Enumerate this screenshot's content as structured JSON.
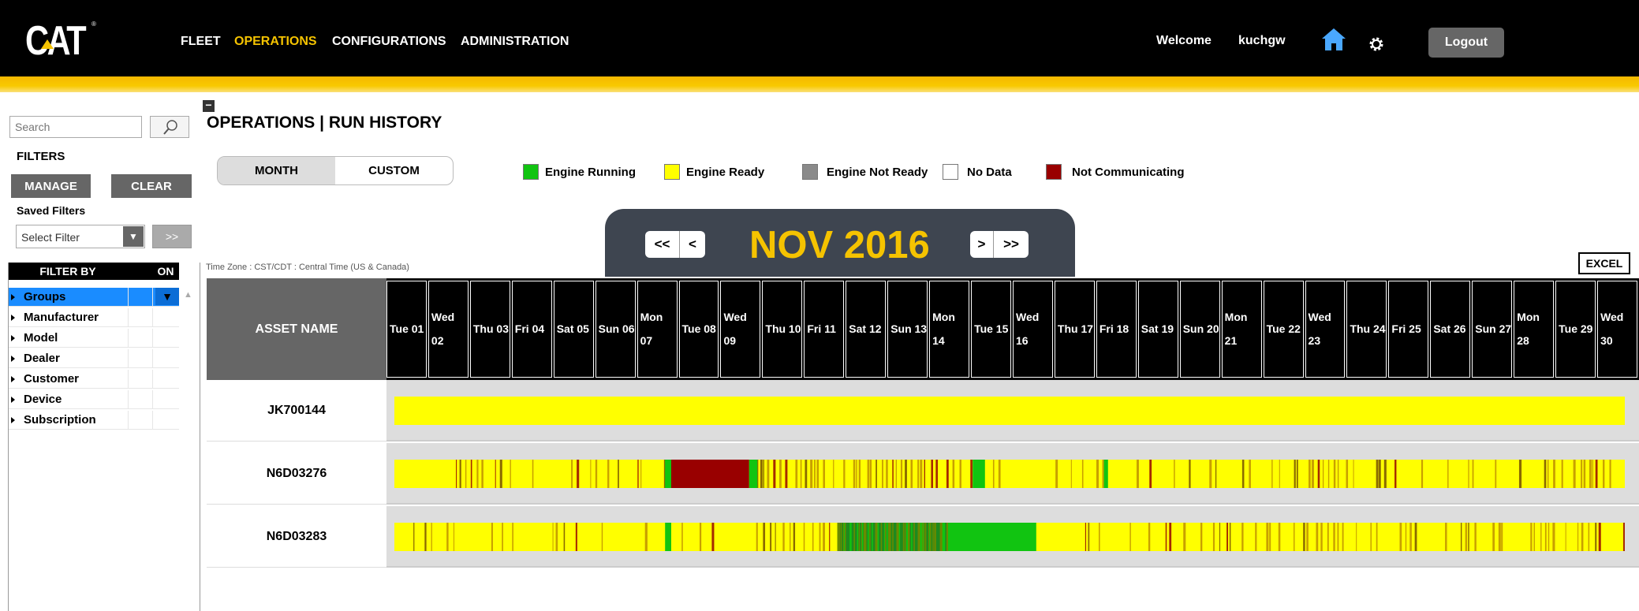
{
  "header": {
    "logo": "CAT",
    "nav": [
      "FLEET",
      "OPERATIONS",
      "CONFIGURATIONS",
      "ADMINISTRATION"
    ],
    "active_nav": "OPERATIONS",
    "welcome": "Welcome",
    "username": "kuchgw",
    "logout_label": "Logout",
    "home_icon": "home-icon",
    "settings_icon": "gear-icon"
  },
  "sidebar": {
    "search_placeholder": "Search",
    "filters_label": "FILTERS",
    "manage_label": "MANAGE",
    "clear_label": "CLEAR",
    "saved_filters_label": "Saved Filters",
    "select_filter": "Select Filter",
    "go_label": ">>",
    "filter_by_label": "FILTER BY",
    "on_label": "ON",
    "filter_items": [
      "Groups",
      "Manufacturer",
      "Model",
      "Dealer",
      "Customer",
      "Device",
      "Subscription"
    ],
    "selected_item": "Groups"
  },
  "main": {
    "collapse_label": "−",
    "page_title": "OPERATIONS | RUN HISTORY",
    "view_modes": [
      "MONTH",
      "CUSTOM"
    ],
    "selected_view": "MONTH",
    "legend": [
      {
        "label": "Engine Running",
        "color": "#11c411"
      },
      {
        "label": "Engine Ready",
        "color": "#ffff00"
      },
      {
        "label": "Engine Not Ready",
        "color": "#8a8a8a"
      },
      {
        "label": "No Data",
        "color": "#ffffff"
      },
      {
        "label": "Not Communicating",
        "color": "#990000"
      }
    ],
    "month_title": "NOV 2016",
    "prev_year_label": "<<",
    "prev_month_label": "<",
    "next_month_label": ">",
    "next_year_label": ">>",
    "timezone": "Time Zone : CST/CDT : Central Time (US & Canada)",
    "excel_label": "EXCEL",
    "asset_header": "ASSET NAME",
    "days": [
      [
        "Tue 01",
        ""
      ],
      [
        "Wed",
        "02"
      ],
      [
        "Thu 03",
        ""
      ],
      [
        "Fri 04",
        ""
      ],
      [
        "Sat 05",
        ""
      ],
      [
        "Sun 06",
        ""
      ],
      [
        "Mon",
        "07"
      ],
      [
        "Tue 08",
        ""
      ],
      [
        "Wed",
        "09"
      ],
      [
        "Thu 10",
        ""
      ],
      [
        "Fri 11",
        ""
      ],
      [
        "Sat 12",
        ""
      ],
      [
        "Sun 13",
        ""
      ],
      [
        "Mon",
        "14"
      ],
      [
        "Tue 15",
        ""
      ],
      [
        "Wed",
        "16"
      ],
      [
        "Thu 17",
        ""
      ],
      [
        "Fri 18",
        ""
      ],
      [
        "Sat 19",
        ""
      ],
      [
        "Sun 20",
        ""
      ],
      [
        "Mon",
        "21"
      ],
      [
        "Tue 22",
        ""
      ],
      [
        "Wed",
        "23"
      ],
      [
        "Thu 24",
        ""
      ],
      [
        "Fri 25",
        ""
      ],
      [
        "Sat 26",
        ""
      ],
      [
        "Sun 27",
        ""
      ],
      [
        "Mon",
        "28"
      ],
      [
        "Tue 29",
        ""
      ],
      [
        "Wed",
        "30"
      ]
    ],
    "assets": [
      {
        "name": "JK700144",
        "segments": [
          {
            "from": 0,
            "to": 30,
            "state": "ready"
          }
        ]
      },
      {
        "name": "N6D03276",
        "segments": [
          {
            "from": 0,
            "to": 1.5,
            "state": "ready"
          },
          {
            "from": 6.6,
            "to": 6.75,
            "state": "running"
          },
          {
            "from": 6.75,
            "to": 8.65,
            "state": "not_communicating"
          },
          {
            "from": 8.65,
            "to": 8.85,
            "state": "running"
          },
          {
            "from": 14.1,
            "to": 14.4,
            "state": "running"
          },
          {
            "from": 17.3,
            "to": 17.4,
            "state": "running"
          }
        ],
        "pattern": "striped"
      },
      {
        "name": "N6D03283",
        "segments": [
          {
            "from": 6.6,
            "to": 6.75,
            "state": "running"
          },
          {
            "from": 10.8,
            "to": 13.5,
            "state": "running_mixed"
          },
          {
            "from": 13.5,
            "to": 15.65,
            "state": "running"
          }
        ],
        "pattern": "striped"
      }
    ]
  }
}
